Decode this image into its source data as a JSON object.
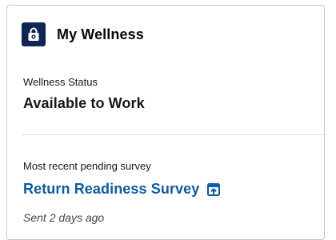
{
  "header": {
    "title": "My Wellness",
    "icon": "lock-icon",
    "icon_bg": "#0d2654"
  },
  "status": {
    "label": "Wellness Status",
    "value": "Available to Work"
  },
  "survey": {
    "label": "Most recent pending survey",
    "link_text": "Return Readiness Survey",
    "link_icon": "external-link-icon",
    "link_color": "#0b5cab",
    "sent_text": "Sent 2 days ago"
  }
}
